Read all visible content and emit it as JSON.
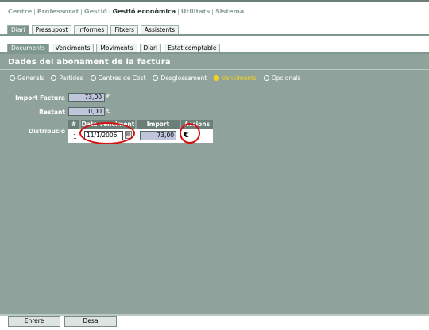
{
  "top_nav": {
    "items": [
      "Centre",
      "Professorat",
      "Gestió",
      "Gestió econòmica",
      "Utilitats",
      "Sistema"
    ],
    "active": "Gestió econòmica",
    "separator": "|"
  },
  "tabs_primary": [
    "Diari",
    "Pressupost",
    "Informes",
    "Fitxers",
    "Assistents"
  ],
  "tabs_primary_active": "Diari",
  "tabs_secondary": [
    "Documents",
    "Venciments",
    "Moviments",
    "Diari",
    "Estat comptable"
  ],
  "tabs_secondary_active": "Documents",
  "panel": {
    "title": "Dades del abonament de la factura",
    "radio_options": [
      "Generals",
      "Partides",
      "Centres de Cost",
      "Desglossament",
      "Venciments",
      "Opcionals"
    ],
    "radio_selected": "Venciments",
    "import_factura_label": "Import Factura",
    "import_factura_value": "73,00",
    "restant_label": "Restant",
    "restant_value": "0,00",
    "currency_symbol": "€",
    "distribucio_label": "Distribució",
    "grid": {
      "headers": [
        "#",
        "Data venciment",
        "Import",
        "Accions"
      ],
      "rows": [
        {
          "num": "1",
          "date": "11/1/2006",
          "amount": "73,00",
          "action": "€"
        }
      ]
    }
  },
  "footer": {
    "back_label": "Enrere",
    "save_label": "Desa"
  },
  "colors": {
    "panel_bg": "#8fa39c",
    "accent_header": "#6b7f78",
    "selected_radio": "#f2d31c",
    "annotation": "#d51010"
  }
}
